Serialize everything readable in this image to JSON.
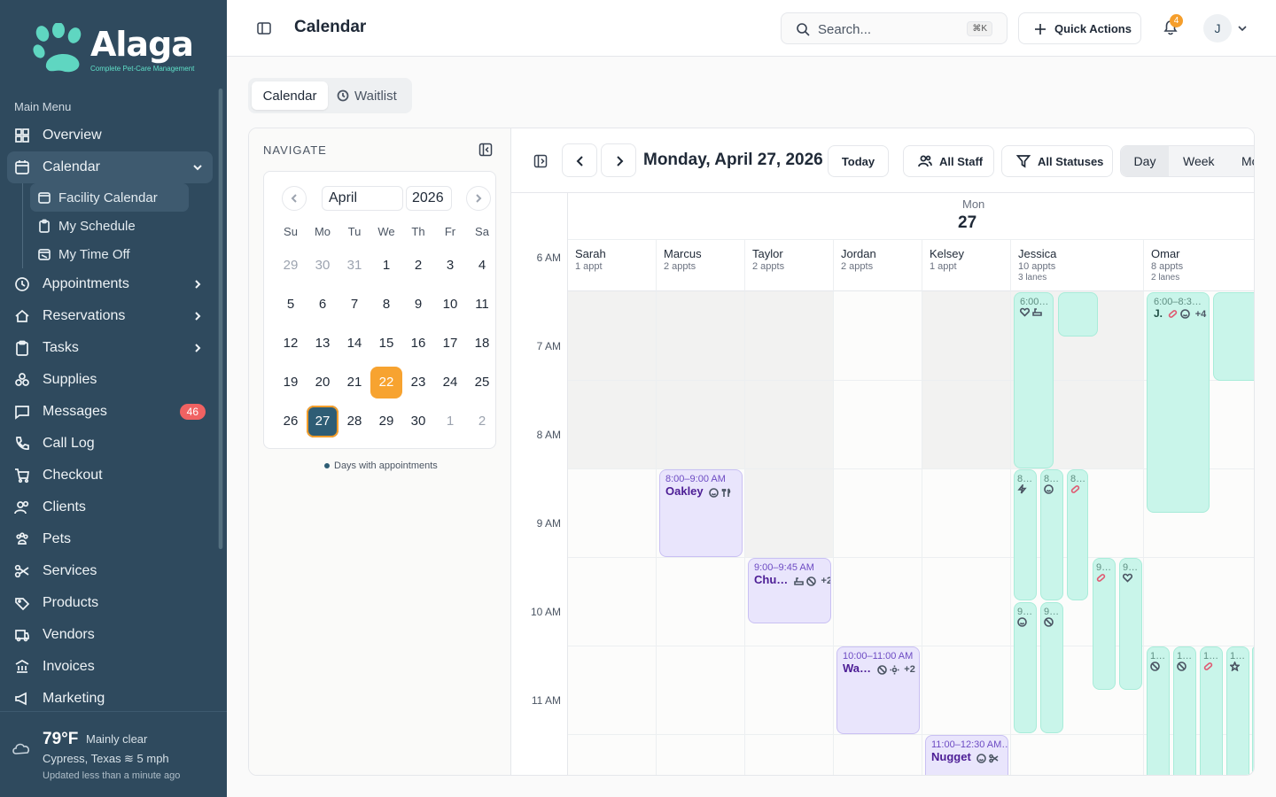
{
  "brand": {
    "name": "Alaga",
    "tagline": "Complete Pet-Care Management"
  },
  "sidebar": {
    "heading": "Main Menu",
    "items": [
      {
        "label": "Overview",
        "icon": "grid-icon"
      },
      {
        "label": "Calendar",
        "icon": "calendar-icon"
      },
      {
        "label": "Appointments",
        "icon": "calendar-icon"
      },
      {
        "label": "Reservations",
        "icon": "home-icon"
      },
      {
        "label": "Tasks",
        "icon": "clipboard-icon"
      },
      {
        "label": "Supplies",
        "icon": "boxes-icon"
      },
      {
        "label": "Messages",
        "icon": "message-icon",
        "badge": "46"
      },
      {
        "label": "Call Log",
        "icon": "phone-icon"
      },
      {
        "label": "Checkout",
        "icon": "cart-icon"
      },
      {
        "label": "Clients",
        "icon": "users-icon"
      },
      {
        "label": "Pets",
        "icon": "paw-icon"
      },
      {
        "label": "Services",
        "icon": "scissors-icon"
      },
      {
        "label": "Products",
        "icon": "products-icon"
      },
      {
        "label": "Vendors",
        "icon": "vendors-icon"
      },
      {
        "label": "Invoices",
        "icon": "invoice-icon"
      },
      {
        "label": "Marketing",
        "icon": "megaphone-icon"
      }
    ],
    "calendar_sub": [
      {
        "label": "Facility Calendar"
      },
      {
        "label": "My Schedule"
      },
      {
        "label": "My Time Off"
      }
    ]
  },
  "weather": {
    "temp": "79°F",
    "condition": "Mainly clear",
    "location": "Cypress, Texas",
    "wind": "5 mph",
    "updated": "Updated less than a minute ago"
  },
  "header": {
    "title": "Calendar",
    "search_placeholder": "Search...",
    "search_shortcut": "⌘K",
    "quick_actions": "Quick Actions",
    "notif_count": "4",
    "avatar_initial": "J"
  },
  "tabs": {
    "calendar": "Calendar",
    "waitlist": "Waitlist"
  },
  "navigate": {
    "title": "NAVIGATE",
    "month": "April",
    "year": "2026",
    "dows": [
      "Su",
      "Mo",
      "Tu",
      "We",
      "Th",
      "Fr",
      "Sa"
    ],
    "weeks": [
      [
        "29",
        "30",
        "31",
        "1",
        "2",
        "3",
        "4"
      ],
      [
        "5",
        "6",
        "7",
        "8",
        "9",
        "10",
        "11"
      ],
      [
        "12",
        "13",
        "14",
        "15",
        "16",
        "17",
        "18"
      ],
      [
        "19",
        "20",
        "21",
        "22",
        "23",
        "24",
        "25"
      ],
      [
        "26",
        "27",
        "28",
        "29",
        "30",
        "1",
        "2"
      ]
    ],
    "legend": "Days with appointments"
  },
  "toolbar": {
    "date": "Monday, April 27, 2026",
    "today": "Today",
    "staff_filter": "All Staff",
    "status_filter": "All Statuses",
    "views": [
      "Day",
      "Week",
      "Mo"
    ]
  },
  "day": {
    "name": "Mon",
    "num": "27"
  },
  "hours": [
    "6 AM",
    "7 AM",
    "8 AM",
    "9 AM",
    "10 AM",
    "11 AM"
  ],
  "staff": [
    {
      "name": "Sarah",
      "count": "1 appt"
    },
    {
      "name": "Marcus",
      "count": "2 appts"
    },
    {
      "name": "Taylor",
      "count": "2 appts"
    },
    {
      "name": "Jordan",
      "count": "2 appts"
    },
    {
      "name": "Kelsey",
      "count": "1 appt"
    },
    {
      "name": "Jessica",
      "count": "10 appts",
      "lanes": "3 lanes"
    },
    {
      "name": "Omar",
      "count": "8 appts",
      "lanes": "2 lanes"
    }
  ],
  "appointments": {
    "oakley": {
      "time": "8:00–9:00 AM",
      "name": "Oakley"
    },
    "chu": {
      "time": "9:00–9:45 AM",
      "name": "Chu…",
      "more": "+2"
    },
    "wa": {
      "time": "10:00–11:00 AM",
      "name": "Wa…",
      "more": "+2"
    },
    "nugget": {
      "time": "11:00–12:30 AM…",
      "name": "Nugget"
    },
    "jessica1": {
      "time": "6:00…"
    },
    "omar1": {
      "time": "6:00–8:3…",
      "name": "J.",
      "more": "+4"
    },
    "j_8a": {
      "time": "8…"
    },
    "j_8b": {
      "time": "8…"
    },
    "j_8c": {
      "time": "8…"
    },
    "j_9a": {
      "time": "9…"
    },
    "j_9b": {
      "time": "9…"
    },
    "j_930a": {
      "time": "9…"
    },
    "j_930b": {
      "time": "9…"
    },
    "o_10a": {
      "time": "1…"
    },
    "o_10b": {
      "time": "1…"
    },
    "o_10c": {
      "time": "1…"
    },
    "o_10d": {
      "time": "1…"
    }
  }
}
